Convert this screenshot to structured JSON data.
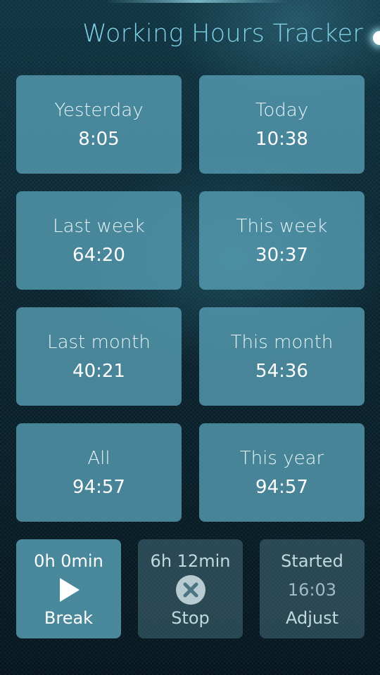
{
  "header": {
    "title": "Working Hours Tracker"
  },
  "stats": [
    {
      "label": "Yesterday",
      "value": "8:05"
    },
    {
      "label": "Today",
      "value": "10:38"
    },
    {
      "label": "Last week",
      "value": "64:20"
    },
    {
      "label": "This week",
      "value": "30:37"
    },
    {
      "label": "Last month",
      "value": "40:21"
    },
    {
      "label": "This month",
      "value": "54:36"
    },
    {
      "label": "All",
      "value": "94:57"
    },
    {
      "label": "This year",
      "value": "94:57"
    }
  ],
  "controls": {
    "break": {
      "duration": "0h 0min",
      "label": "Break",
      "icon": "play-icon"
    },
    "stop": {
      "duration": "6h 12min",
      "label": "Stop",
      "icon": "close-circle-icon"
    },
    "adjust": {
      "top": "Started",
      "time": "16:03",
      "label": "Adjust"
    }
  },
  "colors": {
    "accent_title": "#7fd0e6",
    "card_background": "#58a0b6",
    "background": "#0b2733"
  }
}
